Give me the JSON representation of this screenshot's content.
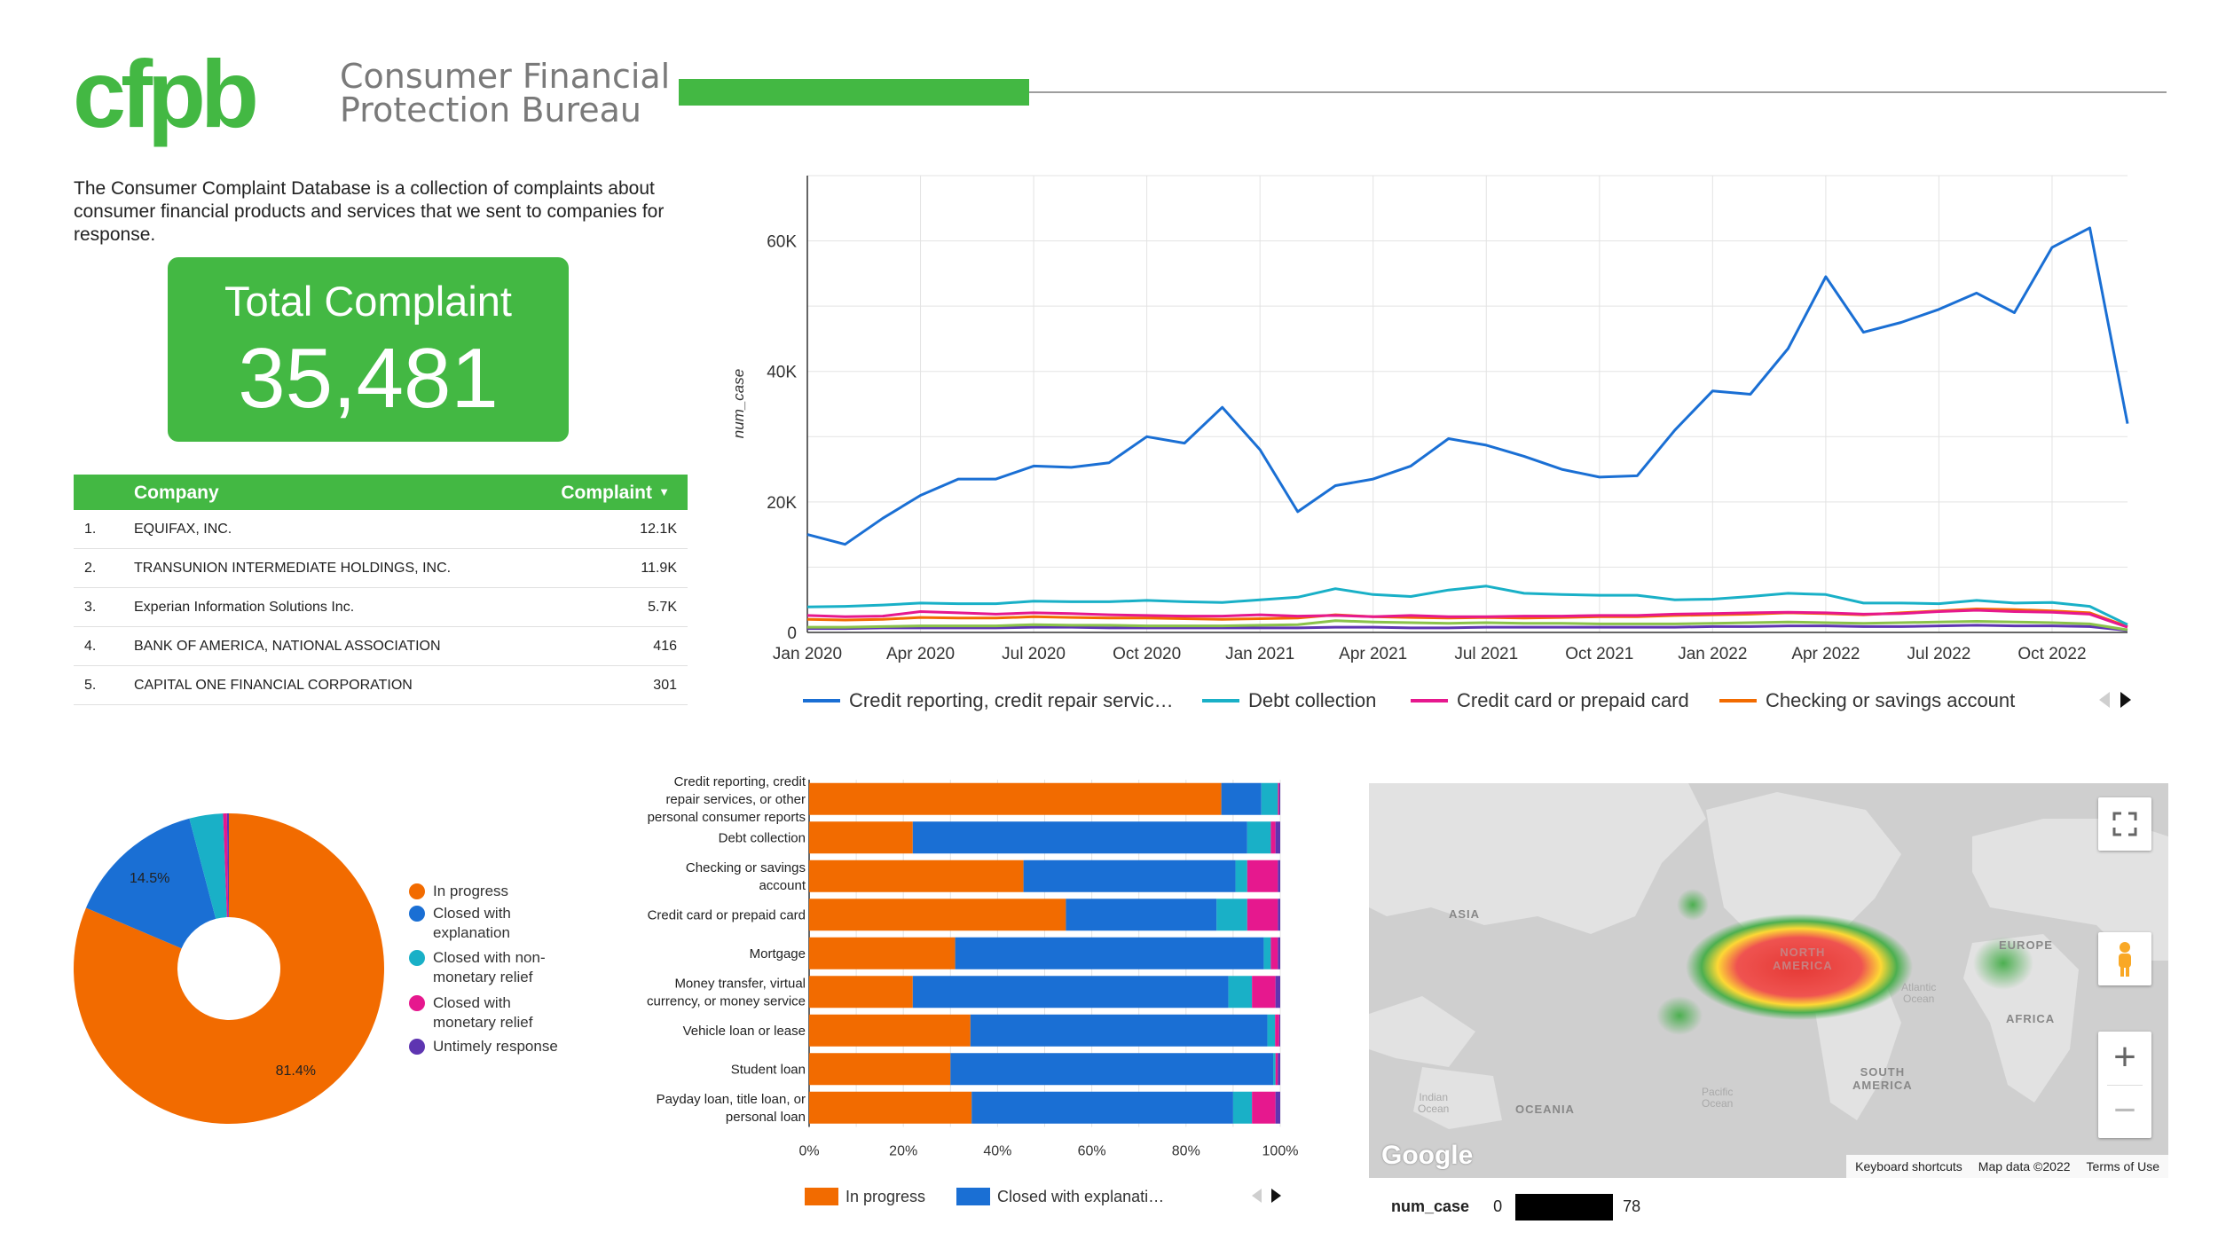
{
  "header": {
    "logo_text": "cfpb",
    "brand_line1": "Consumer Financial",
    "brand_line2": "Protection Bureau"
  },
  "description": "The Consumer Complaint Database is a collection of complaints about consumer financial products and services that we sent to companies for response.",
  "total": {
    "label": "Total Complaint",
    "value": "35,481"
  },
  "table": {
    "headers": {
      "company": "Company",
      "complaint": "Complaint"
    },
    "rows": [
      {
        "idx": "1.",
        "company": "EQUIFAX, INC.",
        "value": "12.1K"
      },
      {
        "idx": "2.",
        "company": "TRANSUNION INTERMEDIATE HOLDINGS, INC.",
        "value": "11.9K"
      },
      {
        "idx": "3.",
        "company": "Experian Information Solutions Inc.",
        "value": "5.7K"
      },
      {
        "idx": "4.",
        "company": "BANK OF AMERICA, NATIONAL ASSOCIATION",
        "value": "416"
      },
      {
        "idx": "5.",
        "company": "CAPITAL ONE FINANCIAL CORPORATION",
        "value": "301"
      }
    ]
  },
  "colors": {
    "brand_green": "#43b843",
    "blue": "#1a6fd4",
    "teal": "#19b0c7",
    "magenta": "#e6188e",
    "orange": "#f26b00",
    "purple": "#5e35b1"
  },
  "chart_data": [
    {
      "type": "line",
      "ylabel": "num_case",
      "ylim": [
        0,
        70000
      ],
      "yticks": [
        0,
        20000,
        40000,
        60000
      ],
      "ytick_labels": [
        "0",
        "20K",
        "40K",
        "60K"
      ],
      "xtick_labels": [
        "Jan 2020",
        "Apr 2020",
        "Jul 2020",
        "Oct 2020",
        "Jan 2021",
        "Apr 2021",
        "Jul 2021",
        "Oct 2021",
        "Jan 2022",
        "Apr 2022",
        "Jul 2022",
        "Oct 2022"
      ],
      "legend": [
        "Credit reporting, credit repair servic…",
        "Debt collection",
        "Credit card or prepaid card",
        "Checking or savings account"
      ],
      "legend_position": "bottom",
      "grid": true,
      "x": [
        "2020-01",
        "2020-02",
        "2020-03",
        "2020-04",
        "2020-05",
        "2020-06",
        "2020-07",
        "2020-08",
        "2020-09",
        "2020-10",
        "2020-11",
        "2020-12",
        "2021-01",
        "2021-02",
        "2021-03",
        "2021-04",
        "2021-05",
        "2021-06",
        "2021-07",
        "2021-08",
        "2021-09",
        "2021-10",
        "2021-11",
        "2021-12",
        "2022-01",
        "2022-02",
        "2022-03",
        "2022-04",
        "2022-05",
        "2022-06",
        "2022-07",
        "2022-08",
        "2022-09",
        "2022-10",
        "2022-11",
        "2022-12"
      ],
      "series": [
        {
          "name": "Credit reporting, credit repair servic…",
          "color": "#1a6fd4",
          "values": [
            15000,
            13500,
            17500,
            21000,
            23500,
            23500,
            25500,
            25300,
            26000,
            30000,
            29000,
            34500,
            28000,
            18500,
            22500,
            23500,
            25500,
            29700,
            28700,
            27000,
            25000,
            23800,
            24000,
            31000,
            37000,
            36500,
            43500,
            54500,
            46000,
            47500,
            49500,
            52000,
            49000,
            59000,
            62000,
            32000
          ]
        },
        {
          "name": "Debt collection",
          "color": "#19b0c7",
          "values": [
            3900,
            4000,
            4200,
            4500,
            4400,
            4400,
            4800,
            4700,
            4700,
            4900,
            4700,
            4600,
            5000,
            5400,
            6700,
            5800,
            5500,
            6500,
            7100,
            6000,
            5800,
            5700,
            5700,
            5000,
            5100,
            5500,
            6000,
            5800,
            4500,
            4500,
            4400,
            4900,
            4500,
            4600,
            4000,
            1200
          ]
        },
        {
          "name": "Credit card or prepaid card",
          "color": "#e6188e",
          "values": [
            2600,
            2400,
            2500,
            3200,
            3000,
            2800,
            3000,
            2900,
            2700,
            2600,
            2500,
            2500,
            2700,
            2500,
            2600,
            2400,
            2600,
            2400,
            2400,
            2500,
            2500,
            2600,
            2600,
            2800,
            2900,
            3000,
            3100,
            3000,
            2800,
            2900,
            3200,
            3400,
            3200,
            3100,
            2800,
            800
          ]
        },
        {
          "name": "Checking or savings account",
          "color": "#f26b00",
          "values": [
            2000,
            1900,
            2000,
            2300,
            2200,
            2200,
            2400,
            2300,
            2200,
            2200,
            2100,
            2000,
            2100,
            2200,
            2700,
            2400,
            2300,
            2200,
            2300,
            2200,
            2300,
            2400,
            2400,
            2600,
            2700,
            2800,
            3000,
            2900,
            2700,
            3000,
            3300,
            3600,
            3500,
            3300,
            3000,
            900
          ]
        },
        {
          "name": "",
          "color": "#8bc34a",
          "values": [
            800,
            800,
            900,
            1000,
            1000,
            1000,
            1200,
            1100,
            1100,
            1000,
            1000,
            1000,
            1100,
            1200,
            1800,
            1600,
            1500,
            1400,
            1500,
            1400,
            1400,
            1300,
            1300,
            1300,
            1400,
            1500,
            1600,
            1500,
            1400,
            1500,
            1600,
            1700,
            1600,
            1500,
            1300,
            400
          ]
        },
        {
          "name": "",
          "color": "#5e35b1",
          "values": [
            600,
            600,
            700,
            700,
            700,
            700,
            800,
            800,
            700,
            700,
            700,
            700,
            700,
            700,
            800,
            800,
            700,
            700,
            800,
            800,
            800,
            800,
            800,
            800,
            900,
            900,
            1000,
            1000,
            900,
            900,
            1000,
            1100,
            1000,
            1000,
            900,
            300
          ]
        }
      ]
    },
    {
      "type": "pie",
      "categories": [
        "In progress",
        "Closed with explanation",
        "Closed with non-monetary relief",
        "Closed with monetary relief",
        "Untimely response"
      ],
      "values": [
        81.4,
        14.5,
        3.5,
        0.4,
        0.2
      ],
      "colors": [
        "#f26b00",
        "#1a6fd4",
        "#19b0c7",
        "#e6188e",
        "#5e35b1"
      ],
      "slice_labels": [
        "81.4%",
        "14.5%",
        "",
        "",
        ""
      ],
      "legend_labels": [
        [
          "In progress"
        ],
        [
          "Closed with",
          "explanation"
        ],
        [
          "Closed with non-",
          "monetary relief"
        ],
        [
          "Closed with",
          "monetary relief"
        ],
        [
          "Untimely response"
        ]
      ],
      "donut": true
    },
    {
      "type": "bar",
      "orientation": "horizontal",
      "stacked": "percent",
      "categories": [
        [
          "Credit reporting, credit",
          "repair services, or other",
          "personal consumer reports"
        ],
        [
          "Debt collection"
        ],
        [
          "Checking or savings",
          "account"
        ],
        [
          "Credit card or prepaid card"
        ],
        [
          "Mortgage"
        ],
        [
          "Money transfer, virtual",
          "currency, or money service"
        ],
        [
          "Vehicle loan or lease"
        ],
        [
          "Student loan"
        ],
        [
          "Payday loan, title loan, or",
          "personal loan"
        ]
      ],
      "xticks": [
        "0%",
        "20%",
        "40%",
        "60%",
        "80%",
        "100%"
      ],
      "legend": [
        "In progress",
        "Closed with explanati…"
      ],
      "series": [
        {
          "name": "In progress",
          "color": "#f26b00",
          "values": [
            87.5,
            22,
            45.5,
            54.5,
            31,
            22,
            31.5,
            30,
            34.5
          ]
        },
        {
          "name": "Closed with explanation",
          "color": "#1a6fd4",
          "values": [
            8.5,
            71,
            45,
            32,
            65.5,
            67,
            58,
            68.5,
            55.5
          ]
        },
        {
          "name": "Closed with non-monetary relief",
          "color": "#19b0c7",
          "values": [
            3.5,
            5,
            2.5,
            6.5,
            1.5,
            5,
            1.5,
            0.5,
            4
          ]
        },
        {
          "name": "Closed with monetary relief",
          "color": "#e6188e",
          "values": [
            0.3,
            1,
            6.5,
            6.5,
            1.5,
            5,
            0.8,
            0.5,
            5
          ]
        },
        {
          "name": "Untimely response",
          "color": "#5e35b1",
          "values": [
            0.2,
            1,
            0.5,
            0.5,
            0.5,
            1,
            0.2,
            0.5,
            1
          ]
        }
      ]
    }
  ],
  "map": {
    "labels": {
      "asia": "ASIA",
      "north_america": "NORTH\nAMERICA",
      "europe": "EUROPE",
      "africa": "AFRICA",
      "south_america": "SOUTH\nAMERICA",
      "oceania": "OCEANIA"
    },
    "oceans": {
      "atlantic": "Atlantic\nOcean",
      "indian": "Indian\nOcean",
      "pacific": "Pacific\nOcean"
    },
    "google": "Google",
    "footer": {
      "shortcuts": "Keyboard shortcuts",
      "map_data": "Map data ©2022",
      "terms": "Terms of Use"
    },
    "scale": {
      "label": "num_case",
      "min": "0",
      "max": "78"
    }
  }
}
